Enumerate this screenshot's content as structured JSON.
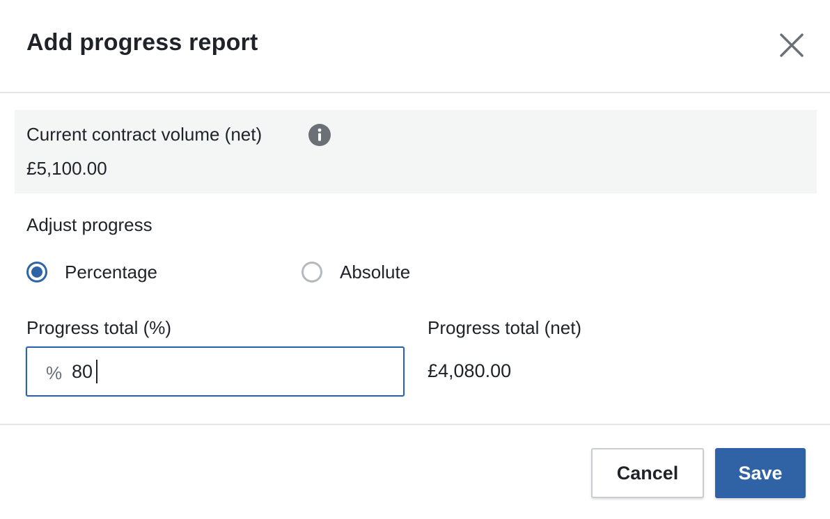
{
  "dialog": {
    "title": "Add progress report",
    "close_icon": "close-icon"
  },
  "contract": {
    "label": "Current contract volume (net)",
    "info_icon": "info-icon",
    "value": "£5,100.00"
  },
  "adjust": {
    "label": "Adjust progress",
    "options": [
      {
        "label": "Percentage",
        "selected": true
      },
      {
        "label": "Absolute",
        "selected": false
      }
    ]
  },
  "progress_percent": {
    "label": "Progress total (%)",
    "prefix": "%",
    "value": "80"
  },
  "progress_net": {
    "label": "Progress total (net)",
    "value": "£4,080.00"
  },
  "footer": {
    "cancel_label": "Cancel",
    "save_label": "Save"
  },
  "colors": {
    "accent": "#2f63a5",
    "panel_background": "#f4f5f5",
    "text": "#1f2329"
  }
}
